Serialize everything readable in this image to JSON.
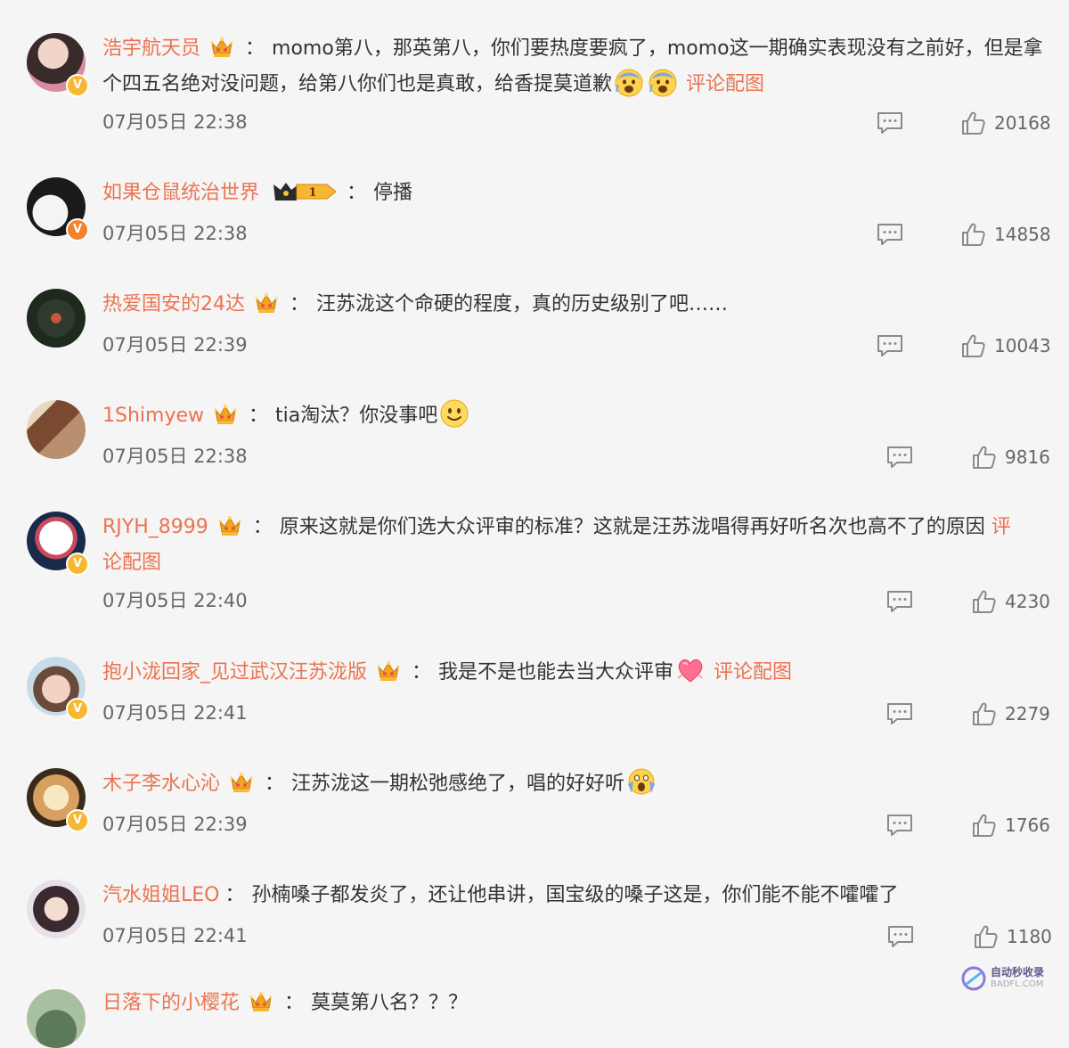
{
  "comments": [
    {
      "username": "浩宇航天员",
      "badge": "crown",
      "text": "momo第八，那英第八，你们要热度要疯了，momo这一期确实表现没有之前好，但是拿个四五名绝对没问题，给第八你们也是真敢，给香提莫道歉",
      "emojis": [
        "fearful-face-icon",
        "fearful-face-icon"
      ],
      "pic_label": "评论配图",
      "timestamp": "07月05日 22:38",
      "likes": "20168"
    },
    {
      "username": "如果仓鼠统治世界",
      "badge": "vip-1",
      "text": "停播",
      "timestamp": "07月05日 22:38",
      "likes": "14858"
    },
    {
      "username": "热爱国安的24达",
      "badge": "crown",
      "text": "汪苏泷这个命硬的程度，真的历史级别了吧……",
      "timestamp": "07月05日 22:39",
      "likes": "10043"
    },
    {
      "username": "1Shimyew",
      "badge": "crown",
      "text": "tia淘汰？你没事吧",
      "emojis": [
        "smile-face-icon"
      ],
      "timestamp": "07月05日 22:38",
      "likes": "9816"
    },
    {
      "username": "RJYH_8999",
      "badge": "crown",
      "text": "原来这就是你们选大众评审的标准？这就是汪苏泷唱得再好听名次也高不了的原因",
      "pic_label_part1": "评",
      "pic_label_part2": "论配图",
      "timestamp": "07月05日 22:40",
      "likes": "4230"
    },
    {
      "username": "抱小泷回家_见过武汉汪苏泷版",
      "badge": "crown",
      "text": "我是不是也能去当大众评审",
      "emojis": [
        "heart-icon"
      ],
      "pic_label": "评论配图",
      "timestamp": "07月05日 22:41",
      "likes": "2279"
    },
    {
      "username": "木子李水心沁",
      "badge": "crown",
      "text": "汪苏泷这一期松弛感绝了，唱的好好听",
      "emojis": [
        "screaming-face-icon"
      ],
      "timestamp": "07月05日 22:39",
      "likes": "1766"
    },
    {
      "username": "汽水姐姐LEO",
      "text": "孙楠嗓子都发炎了，还让他串讲，国宝级的嗓子这是，你们能不能不嚯嚯了",
      "timestamp": "07月05日 22:41",
      "likes": "1180"
    },
    {
      "username": "日落下的小樱花",
      "badge": "crown",
      "text": "莫莫第八名？？？"
    }
  ],
  "colon": "：",
  "vip_level": "1",
  "watermark": {
    "line1": "自动秒收录",
    "line2": "BADFL.COM"
  },
  "colors": {
    "username": "#eb7350",
    "text": "#333333",
    "meta": "#666666",
    "background": "#f5f5f5"
  }
}
